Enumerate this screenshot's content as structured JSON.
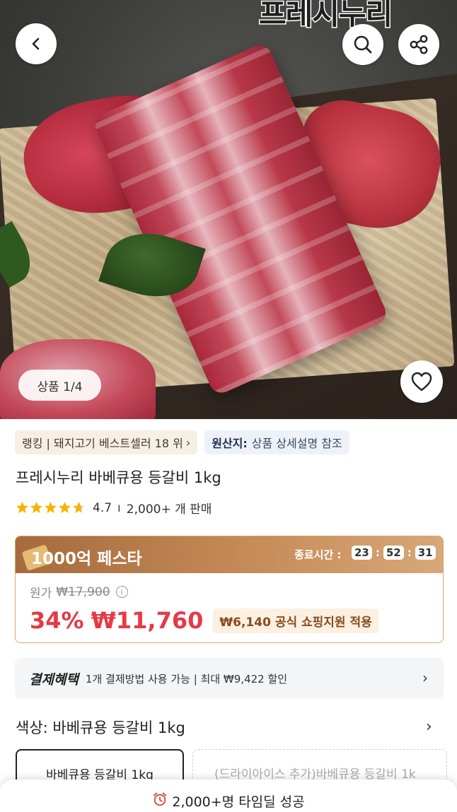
{
  "brand": {
    "logo_text": "프레시누리"
  },
  "hero": {
    "image_counter": "상품 1/4",
    "icons": {
      "back": "chevron-left-icon",
      "search": "search-icon",
      "share": "share-icon",
      "wishlist": "heart-icon"
    }
  },
  "chips": {
    "ranking": "랭킹 | 돼지고기 베스트셀러 18 위",
    "origin_label": "원산지:",
    "origin_value": "상품 상세설명 참조"
  },
  "product": {
    "title": "프레시누리 바베큐용 등갈비 1kg",
    "rating": "4.7",
    "rating_stars": 4.7,
    "sales": "2,000+ 개 판매"
  },
  "festa": {
    "title": "1000억 페스타",
    "end_label": "종료시간 :",
    "timer": {
      "hours": "23",
      "minutes": "52",
      "seconds": "31"
    },
    "original_label": "원가",
    "original_price": "₩17,900",
    "discount": "34%",
    "price": "₩11,760",
    "support": "₩6,140 공식 쇼핑지원 적용",
    "colors": {
      "accent_red": "#e63946",
      "header_brown": "#b57a49"
    }
  },
  "benefit": {
    "title": "결제혜택",
    "text": "1개 결제방법 사용 가능 | 최대 ₩9,422 할인"
  },
  "option": {
    "header": "색상: 바베큐용 등갈비 1kg",
    "items": [
      {
        "label": "바베큐용 등갈비 1kg",
        "selected": true
      },
      {
        "label": "(드라이아이스 추가)바베큐용 등갈비 1k",
        "selected": false
      }
    ]
  },
  "bottom": {
    "timedeal": "2,000+명 타임딜 성공",
    "icon": "alarm-clock-icon"
  }
}
